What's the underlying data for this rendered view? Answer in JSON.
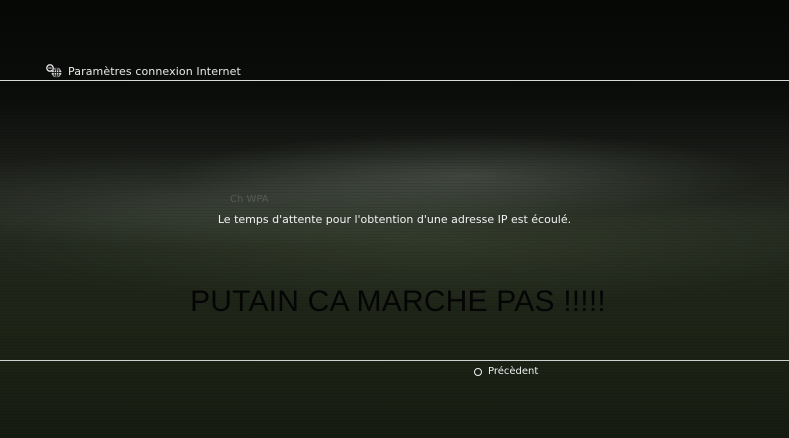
{
  "header": {
    "icon": "network-globe-icon",
    "title": "Paramètres connexion Internet"
  },
  "dialog": {
    "faded_label": "Ch WPA",
    "message": "Le temps d'attente pour l'obtention d'une adresse IP est écoulé."
  },
  "overlay": {
    "text": "PUTAIN CA MARCHE PAS !!!!!"
  },
  "footer": {
    "back_icon": "circle-button-icon",
    "back_label": "Précèdent"
  }
}
